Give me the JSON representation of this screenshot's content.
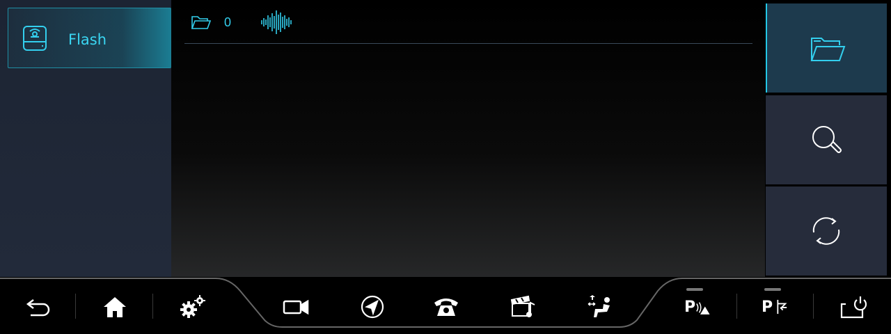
{
  "sidebar": {
    "source": {
      "label": "Flash",
      "icon": "usb-drive-icon",
      "active": true
    }
  },
  "info_bar": {
    "folder_icon": "folder-icon",
    "file_count": "0",
    "audio_icon": "sound-wave-icon"
  },
  "right_panel": {
    "buttons": [
      {
        "name": "browse-folder-button",
        "icon": "folder-open-icon",
        "active": true
      },
      {
        "name": "search-button",
        "icon": "search-icon",
        "active": false
      },
      {
        "name": "refresh-button",
        "icon": "refresh-icon",
        "active": false
      }
    ]
  },
  "bottom_bar": {
    "items": [
      {
        "name": "back-button",
        "icon": "back-arrow-icon"
      },
      {
        "name": "home-button",
        "icon": "home-icon"
      },
      {
        "name": "settings-button",
        "icon": "gears-icon"
      },
      {
        "name": "camera-button",
        "icon": "video-camera-icon"
      },
      {
        "name": "navigation-button",
        "icon": "navigation-icon"
      },
      {
        "name": "phone-button",
        "icon": "phone-icon"
      },
      {
        "name": "media-button",
        "icon": "clapper-music-icon"
      },
      {
        "name": "seat-button",
        "icon": "seat-adjust-icon"
      },
      {
        "name": "park-sensor-button",
        "icon": "parking-sensor-icon",
        "label": "P"
      },
      {
        "name": "park-assist-button",
        "icon": "park-assist-icon",
        "label": "P"
      },
      {
        "name": "power-button",
        "icon": "power-off-icon"
      }
    ]
  },
  "colors": {
    "accent": "#33cfee",
    "sidebar_bg": "#222a3a",
    "panel_button_bg": "#262c3b",
    "panel_active_bg": "#1d3a4d"
  }
}
